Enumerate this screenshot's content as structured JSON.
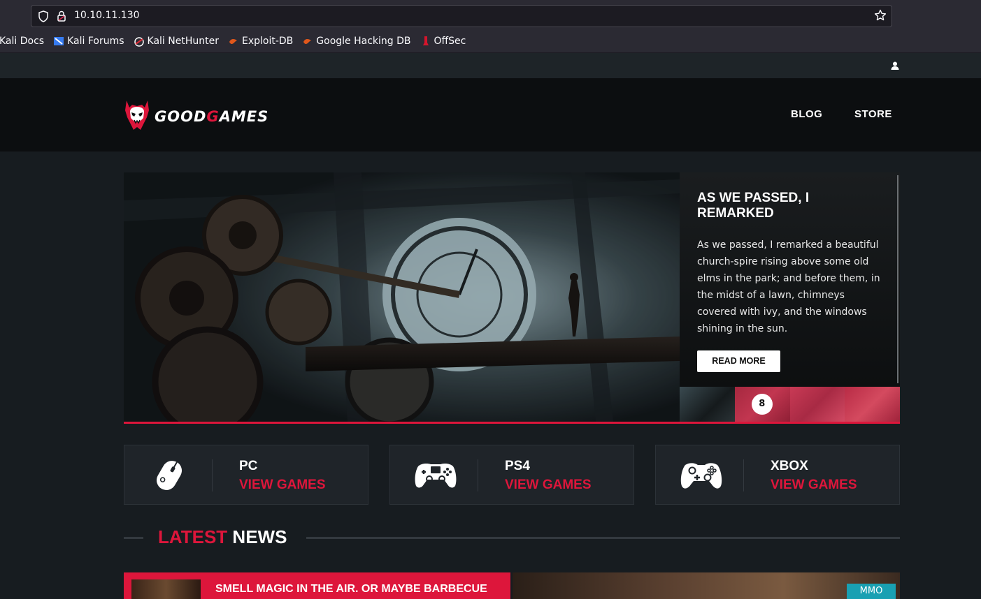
{
  "browser": {
    "url": "10.10.11.130",
    "bookmarks": [
      {
        "label": "Kali Docs",
        "icon": "kali-icon"
      },
      {
        "label": "Kali Forums",
        "icon": "kali-forums-icon"
      },
      {
        "label": "Kali NetHunter",
        "icon": "nethunter-icon"
      },
      {
        "label": "Exploit-DB",
        "icon": "exploitdb-icon"
      },
      {
        "label": "Google Hacking DB",
        "icon": "ghdb-icon"
      },
      {
        "label": "OffSec",
        "icon": "offsec-icon"
      }
    ]
  },
  "site": {
    "logo": {
      "part1": "GOOD",
      "part2": "G",
      "part3": "AMES"
    },
    "nav": {
      "blog": "BLOG",
      "store": "STORE"
    },
    "hero": {
      "title": "AS WE PASSED, I REMARKED",
      "text": "As we passed, I remarked a beautiful church-spire rising above some old elms in the park; and before them, in the midst of a lawn, chimneys covered with ivy, and the windows shining in the sun.",
      "button": "READ MORE",
      "badge": "8"
    },
    "categories": [
      {
        "name": "PC",
        "link": "VIEW GAMES",
        "icon": "mouse-icon"
      },
      {
        "name": "PS4",
        "link": "VIEW GAMES",
        "icon": "ps4-controller-icon"
      },
      {
        "name": "XBOX",
        "link": "VIEW GAMES",
        "icon": "xbox-controller-icon"
      }
    ],
    "news": {
      "heading_red": "LATEST",
      "heading_white": " NEWS",
      "card1_title": "SMELL MAGIC IN THE AIR. OR MAYBE BARBECUE",
      "card2_tag": "MMO"
    }
  },
  "colors": {
    "accent": "#dd163b",
    "tag": "#19a0b2"
  }
}
